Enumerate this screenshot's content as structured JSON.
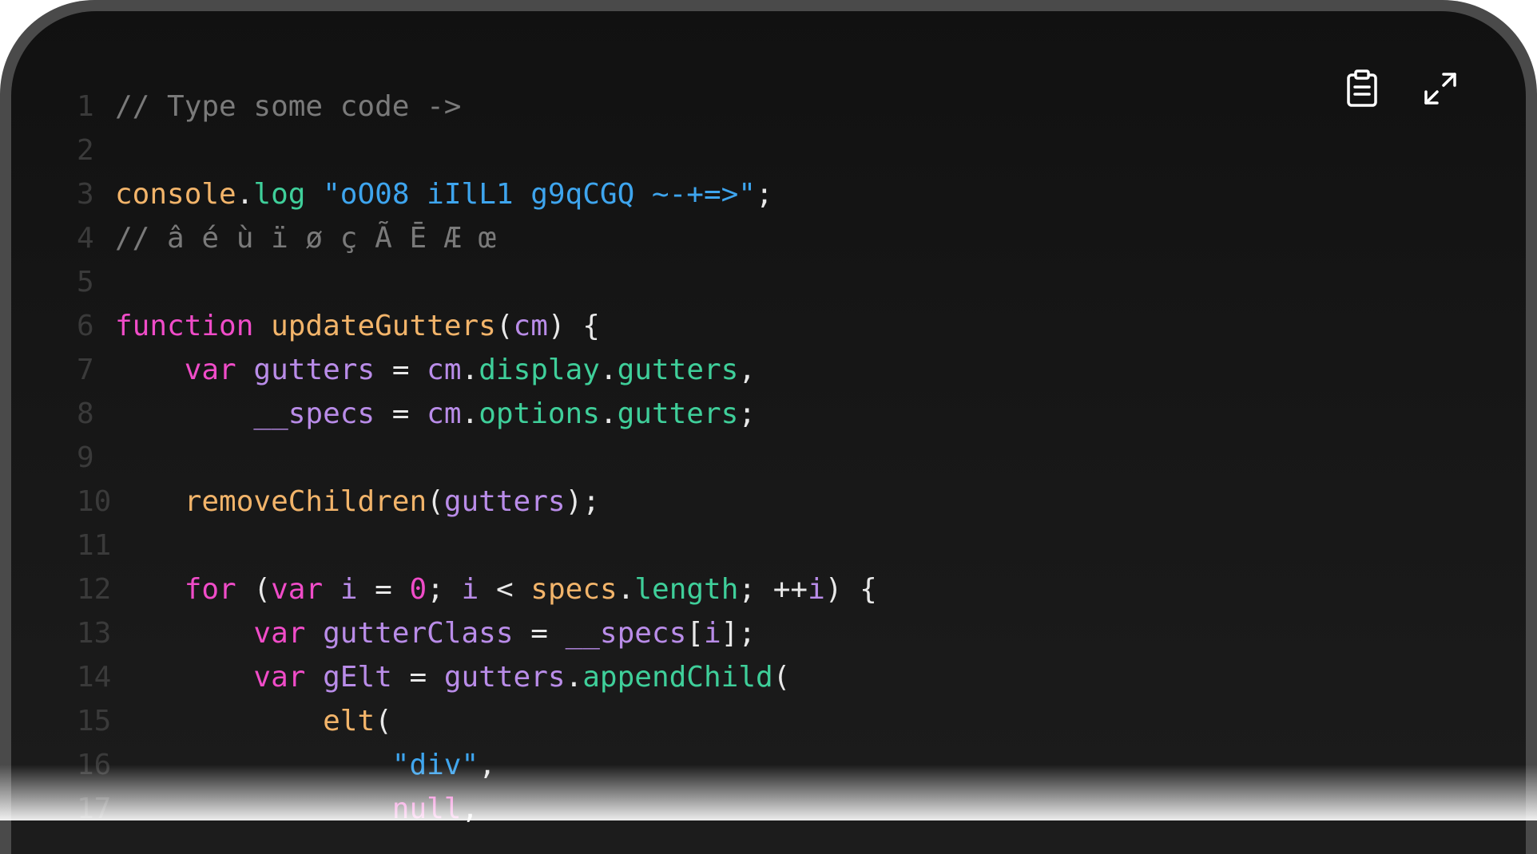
{
  "colors": {
    "comment": "#7a7a7a",
    "plain": "#e8e8e8",
    "keyword": "#f04cc8",
    "variable": "#b98ce8",
    "property": "#3fcf9a",
    "function": "#f2b46a",
    "string": "#3ea5ee",
    "number": "#f04cc8",
    "line_number": "#3a3a3a"
  },
  "toolbar": {
    "copy_icon": "clipboard-icon",
    "expand_icon": "expand-icon"
  },
  "code_lines": [
    {
      "n": "1",
      "tokens": [
        {
          "t": "// Type some code ->",
          "k": "comment"
        }
      ]
    },
    {
      "n": "2",
      "tokens": []
    },
    {
      "n": "3",
      "tokens": [
        {
          "t": "console",
          "k": "function"
        },
        {
          "t": ".",
          "k": "plain"
        },
        {
          "t": "log",
          "k": "property"
        },
        {
          "t": " ",
          "k": "plain"
        },
        {
          "t": "\"oO08 iIlL1 g9qCGQ ~-+=>\"",
          "k": "string"
        },
        {
          "t": ";",
          "k": "plain"
        }
      ]
    },
    {
      "n": "4",
      "tokens": [
        {
          "t": "// â é ù ï ø ç Ã Ē Æ œ",
          "k": "comment"
        }
      ]
    },
    {
      "n": "5",
      "tokens": []
    },
    {
      "n": "6",
      "tokens": [
        {
          "t": "function",
          "k": "keyword"
        },
        {
          "t": " ",
          "k": "plain"
        },
        {
          "t": "updateGutters",
          "k": "function"
        },
        {
          "t": "(",
          "k": "plain"
        },
        {
          "t": "cm",
          "k": "variable"
        },
        {
          "t": ") {",
          "k": "plain"
        }
      ]
    },
    {
      "n": "7",
      "tokens": [
        {
          "t": "    ",
          "k": "plain"
        },
        {
          "t": "var",
          "k": "keyword"
        },
        {
          "t": " ",
          "k": "plain"
        },
        {
          "t": "gutters",
          "k": "variable"
        },
        {
          "t": " = ",
          "k": "plain"
        },
        {
          "t": "cm",
          "k": "variable"
        },
        {
          "t": ".",
          "k": "plain"
        },
        {
          "t": "display",
          "k": "property"
        },
        {
          "t": ".",
          "k": "plain"
        },
        {
          "t": "gutters",
          "k": "property"
        },
        {
          "t": ",",
          "k": "plain"
        }
      ]
    },
    {
      "n": "8",
      "tokens": [
        {
          "t": "        ",
          "k": "plain"
        },
        {
          "t": "__specs",
          "k": "variable"
        },
        {
          "t": " = ",
          "k": "plain"
        },
        {
          "t": "cm",
          "k": "variable"
        },
        {
          "t": ".",
          "k": "plain"
        },
        {
          "t": "options",
          "k": "property"
        },
        {
          "t": ".",
          "k": "plain"
        },
        {
          "t": "gutters",
          "k": "property"
        },
        {
          "t": ";",
          "k": "plain"
        }
      ]
    },
    {
      "n": "9",
      "tokens": []
    },
    {
      "n": "10",
      "tokens": [
        {
          "t": "    ",
          "k": "plain"
        },
        {
          "t": "removeChildren",
          "k": "function"
        },
        {
          "t": "(",
          "k": "plain"
        },
        {
          "t": "gutters",
          "k": "variable"
        },
        {
          "t": ");",
          "k": "plain"
        }
      ]
    },
    {
      "n": "11",
      "tokens": []
    },
    {
      "n": "12",
      "tokens": [
        {
          "t": "    ",
          "k": "plain"
        },
        {
          "t": "for",
          "k": "keyword"
        },
        {
          "t": " (",
          "k": "plain"
        },
        {
          "t": "var",
          "k": "keyword"
        },
        {
          "t": " ",
          "k": "plain"
        },
        {
          "t": "i",
          "k": "variable"
        },
        {
          "t": " = ",
          "k": "plain"
        },
        {
          "t": "0",
          "k": "number"
        },
        {
          "t": "; ",
          "k": "plain"
        },
        {
          "t": "i",
          "k": "variable"
        },
        {
          "t": " < ",
          "k": "plain"
        },
        {
          "t": "specs",
          "k": "function"
        },
        {
          "t": ".",
          "k": "plain"
        },
        {
          "t": "length",
          "k": "property"
        },
        {
          "t": "; ++",
          "k": "plain"
        },
        {
          "t": "i",
          "k": "variable"
        },
        {
          "t": ") {",
          "k": "plain"
        }
      ]
    },
    {
      "n": "13",
      "tokens": [
        {
          "t": "        ",
          "k": "plain"
        },
        {
          "t": "var",
          "k": "keyword"
        },
        {
          "t": " ",
          "k": "plain"
        },
        {
          "t": "gutterClass",
          "k": "variable"
        },
        {
          "t": " = ",
          "k": "plain"
        },
        {
          "t": "__specs",
          "k": "variable"
        },
        {
          "t": "[",
          "k": "plain"
        },
        {
          "t": "i",
          "k": "variable"
        },
        {
          "t": "];",
          "k": "plain"
        }
      ]
    },
    {
      "n": "14",
      "tokens": [
        {
          "t": "        ",
          "k": "plain"
        },
        {
          "t": "var",
          "k": "keyword"
        },
        {
          "t": " ",
          "k": "plain"
        },
        {
          "t": "gElt",
          "k": "variable"
        },
        {
          "t": " = ",
          "k": "plain"
        },
        {
          "t": "gutters",
          "k": "variable"
        },
        {
          "t": ".",
          "k": "plain"
        },
        {
          "t": "appendChild",
          "k": "property"
        },
        {
          "t": "(",
          "k": "plain"
        }
      ]
    },
    {
      "n": "15",
      "tokens": [
        {
          "t": "            ",
          "k": "plain"
        },
        {
          "t": "elt",
          "k": "function"
        },
        {
          "t": "(",
          "k": "plain"
        }
      ]
    },
    {
      "n": "16",
      "tokens": [
        {
          "t": "                ",
          "k": "plain"
        },
        {
          "t": "\"div\"",
          "k": "string"
        },
        {
          "t": ",",
          "k": "plain"
        }
      ]
    },
    {
      "n": "17",
      "tokens": [
        {
          "t": "                ",
          "k": "plain"
        },
        {
          "t": "null",
          "k": "keyword"
        },
        {
          "t": ",",
          "k": "plain"
        }
      ]
    }
  ]
}
